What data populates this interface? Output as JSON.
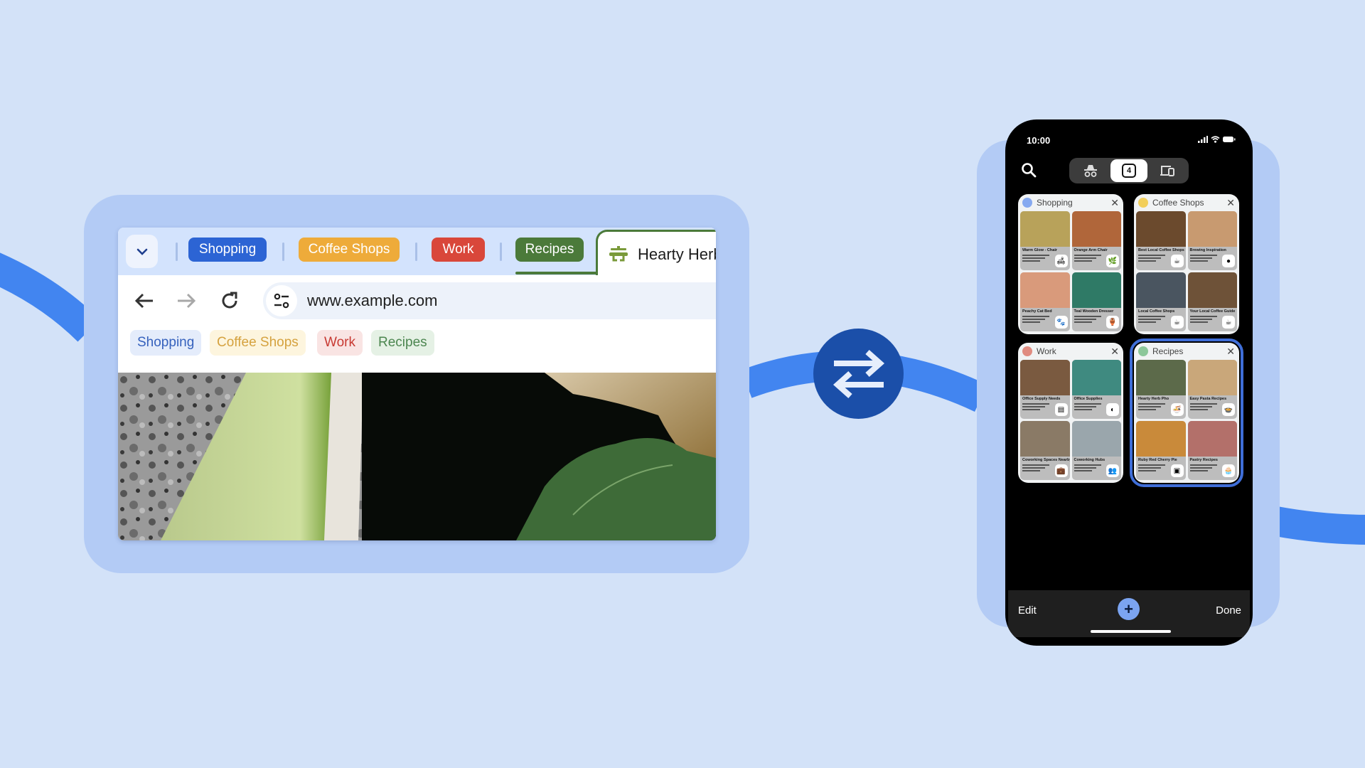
{
  "desktop_browser": {
    "tab_groups": [
      {
        "label": "Shopping",
        "color": "#2c64d4"
      },
      {
        "label": "Coffee Shops",
        "color": "#eeab3a"
      },
      {
        "label": "Work",
        "color": "#d9473a"
      },
      {
        "label": "Recipes",
        "color": "#4b7a3a"
      }
    ],
    "active_tab": {
      "title": "Hearty Herb",
      "icon": "herb-dish-icon"
    },
    "toolbar": {
      "back_icon": "back-arrow-icon",
      "forward_icon": "forward-arrow-icon",
      "reload_icon": "reload-icon",
      "site_settings_icon": "tune-icon",
      "url": "www.example.com"
    },
    "bookmark_chips": [
      {
        "label": "Shopping",
        "text_color": "#3561bd",
        "bg": "#e4ecfb"
      },
      {
        "label": "Coffee Shops",
        "text_color": "#d5a23f",
        "bg": "#fdf5de"
      },
      {
        "label": "Work",
        "text_color": "#c83a33",
        "bg": "#f9e4e3"
      },
      {
        "label": "Recipes",
        "text_color": "#4c8650",
        "bg": "#e5f1e5"
      }
    ]
  },
  "sync_icon": "swap-arrows-icon",
  "phone": {
    "status": {
      "time": "10:00"
    },
    "tab_count": "4",
    "groups": [
      {
        "name": "Shopping",
        "dot_color": "#86a9f0",
        "selected": false,
        "tabs": [
          {
            "title": "Warm Glow - Chair",
            "badge": "🛋",
            "img": "#b8a25a"
          },
          {
            "title": "Orange Arm Chair",
            "badge": "🌿",
            "img": "#b0663a"
          },
          {
            "title": "Peachy Cat Bed",
            "badge": "🐾",
            "img": "#d99a7b"
          },
          {
            "title": "Teal Wooden Dresser",
            "badge": "🏺",
            "img": "#2f7a66"
          }
        ]
      },
      {
        "name": "Coffee Shops",
        "dot_color": "#f2cf5b",
        "selected": false,
        "tabs": [
          {
            "title": "Best Local Coffee Shops",
            "badge": "☕",
            "img": "#6b4a2d"
          },
          {
            "title": "Brewing Inspiration",
            "badge": "●",
            "img": "#c89a70"
          },
          {
            "title": "Local Coffee Shops",
            "badge": "☕",
            "img": "#4a5560"
          },
          {
            "title": "Your Local Coffee Guide",
            "badge": "☕",
            "img": "#6e5238"
          }
        ]
      },
      {
        "name": "Work",
        "dot_color": "#e08b80",
        "selected": false,
        "tabs": [
          {
            "title": "Office Supply Needs",
            "badge": "▤",
            "img": "#7a5a40"
          },
          {
            "title": "Office Supplies",
            "badge": "◐",
            "img": "#3f8a80"
          },
          {
            "title": "Coworking Spaces Nearby",
            "badge": "💼",
            "img": "#8a7a66"
          },
          {
            "title": "Coworking Hubs",
            "badge": "👥",
            "img": "#9aa6ac"
          }
        ]
      },
      {
        "name": "Recipes",
        "dot_color": "#8cc79a",
        "selected": true,
        "tabs": [
          {
            "title": "Hearty Herb Pho",
            "badge": "🍜",
            "img": "#5c6a4a"
          },
          {
            "title": "Easy Pasta Recipes",
            "badge": "🍲",
            "img": "#c9a77a"
          },
          {
            "title": "Ruby Red Cherry Pie",
            "badge": "▣",
            "img": "#c98a3a"
          },
          {
            "title": "Pastry Recipes",
            "badge": "🧁",
            "img": "#b3706a"
          }
        ]
      }
    ],
    "bottom_bar": {
      "edit_label": "Edit",
      "done_label": "Done",
      "add_icon": "plus-icon"
    }
  }
}
